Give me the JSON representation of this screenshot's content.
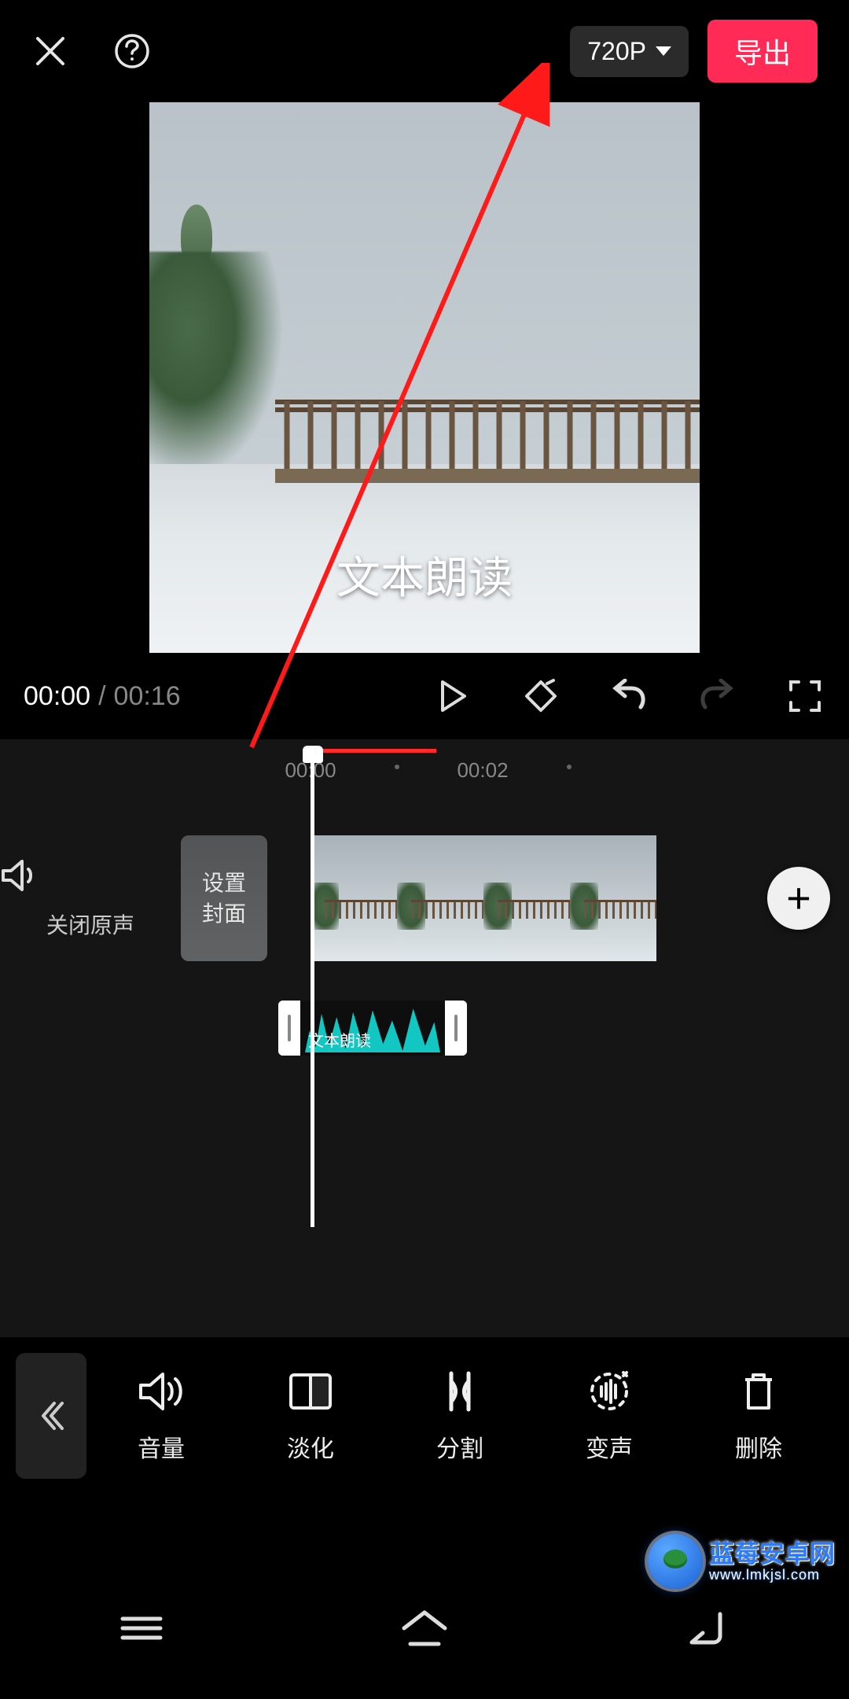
{
  "header": {
    "resolution_label": "720P",
    "export_label": "导出"
  },
  "preview": {
    "overlay_text": "文本朗读"
  },
  "playbar": {
    "current_time": "00:00",
    "separator": "/",
    "duration": "00:16"
  },
  "ruler": {
    "ticks": [
      "00:00",
      "00:02"
    ]
  },
  "mute": {
    "label": "关闭原声"
  },
  "cover": {
    "line1": "设置",
    "line2": "封面"
  },
  "audio_clip": {
    "label": "文本朗读"
  },
  "tools": {
    "volume": "音量",
    "fade": "淡化",
    "split": "分割",
    "voice": "变声",
    "delete": "删除"
  },
  "watermark": {
    "line1": "蓝莓安卓网",
    "line2": "www.lmkjsl.com"
  }
}
